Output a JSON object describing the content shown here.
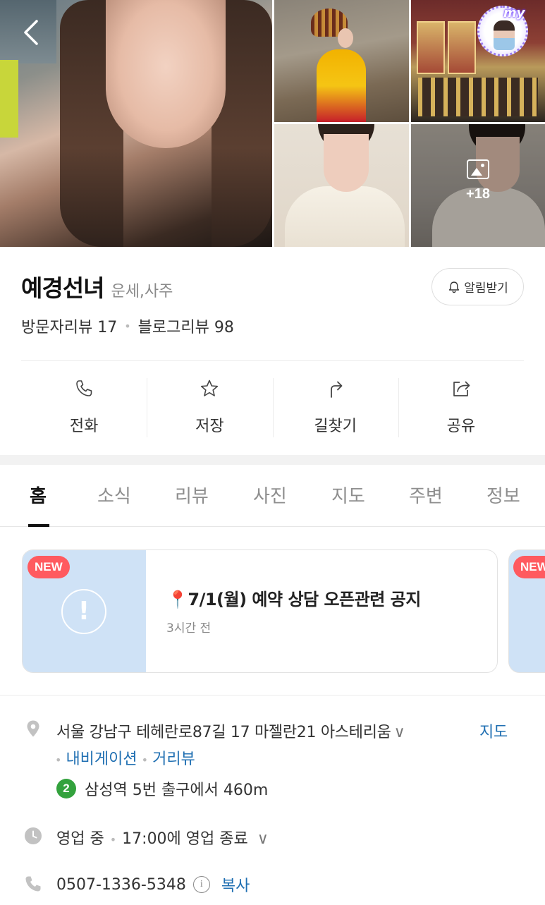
{
  "header": {
    "back_icon": "chevron-left-icon",
    "more_photos_count": "+18",
    "my_badge_text": "my"
  },
  "place": {
    "name": "예경선녀",
    "category": "운세,사주",
    "notify_label": "알림받기",
    "visitor_reviews": "방문자리뷰 17",
    "blog_reviews": "블로그리뷰 98"
  },
  "actions": [
    {
      "label": "전화",
      "icon": "phone-icon"
    },
    {
      "label": "저장",
      "icon": "star-icon"
    },
    {
      "label": "길찾기",
      "icon": "directions-icon"
    },
    {
      "label": "공유",
      "icon": "share-icon"
    }
  ],
  "tabs": [
    {
      "label": "홈",
      "active": true
    },
    {
      "label": "소식",
      "active": false
    },
    {
      "label": "리뷰",
      "active": false
    },
    {
      "label": "사진",
      "active": false
    },
    {
      "label": "지도",
      "active": false
    },
    {
      "label": "주변",
      "active": false
    },
    {
      "label": "정보",
      "active": false
    }
  ],
  "notice": {
    "badge": "NEW",
    "title": "7/1(월) 예약 상담 오픈관련 공지",
    "pin": "📍",
    "time": "3시간 전",
    "exclaim": "!"
  },
  "info": {
    "address": "서울 강남구 테헤란로87길 17 마젤란21 아스테리움",
    "chevron": "∨",
    "map_link": "지도",
    "navigation_link": "내비게이션",
    "street_view_link": "거리뷰",
    "subway_line": "2",
    "subway_text": "삼성역 5번 출구에서 460m",
    "status": "영업 중",
    "hours_text": "17:00에 영업 종료",
    "phone": "0507-1336-5348",
    "info_glyph": "i",
    "copy_label": "복사"
  },
  "colors": {
    "link": "#1f6fb2",
    "new_badge": "#ff5a5f",
    "subway_line2": "#33a23d",
    "notice_thumb": "#cfe2f6"
  }
}
